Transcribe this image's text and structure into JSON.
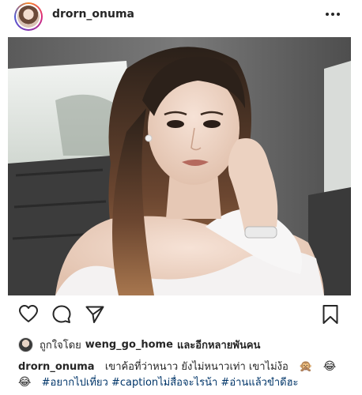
{
  "post": {
    "username": "drorn_onuma",
    "more_icon": "more-horizontal-icon",
    "photo_subject": "woman-in-car-selfie"
  },
  "actions": {
    "like_icon": "heart-icon",
    "comment_icon": "comment-icon",
    "share_icon": "send-icon",
    "save_icon": "bookmark-icon"
  },
  "likes": {
    "prefix": "ถูกใจโดย",
    "liker": "weng_go_home",
    "suffix": "และอีกหลายพันคน"
  },
  "caption": {
    "username": "drorn_onuma",
    "text": "เขาค้อที่ว่าหนาว ยังไม่หนาวเท่า เขาไม่ง้อ",
    "emoji1": "🙊",
    "emoji2": "😂",
    "emoji3": "😂",
    "hashtags": "#อยากไปเที่ยว #captionไม่สื่อจะไรน้า #อ่านแล้วขำดีฮะ"
  },
  "colors": {
    "text": "#262626",
    "hashtag": "#003569",
    "accent": "#dd2a7b"
  }
}
